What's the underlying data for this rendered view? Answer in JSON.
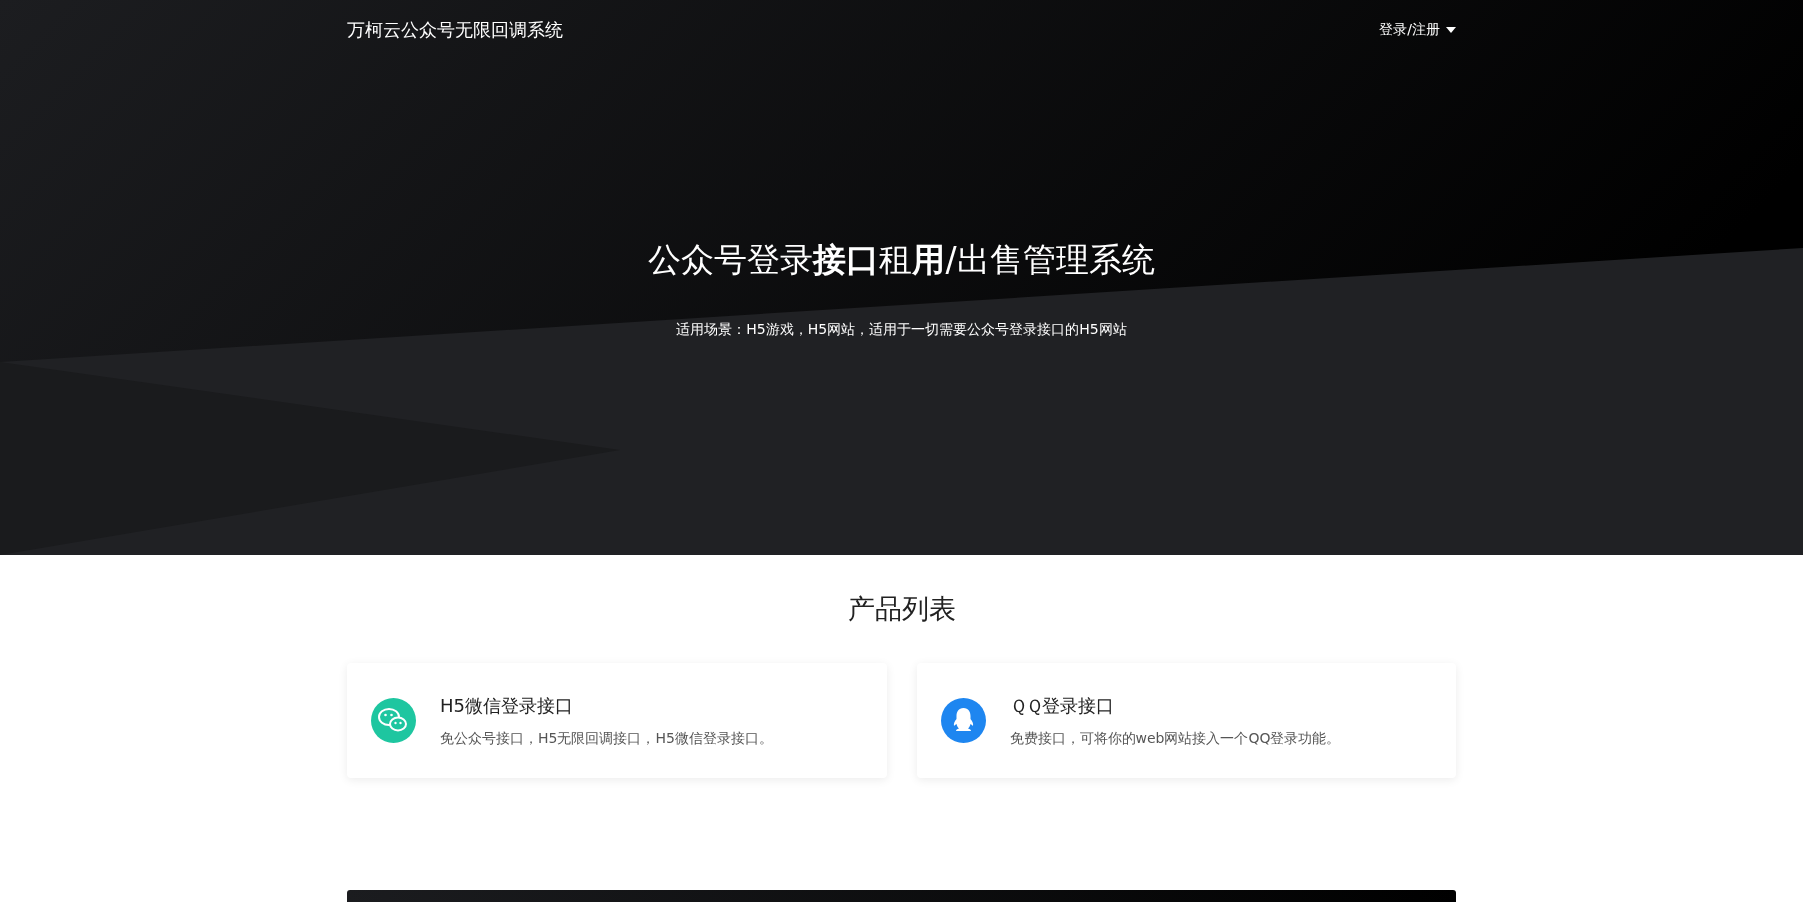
{
  "navbar": {
    "brand": "万柯云公众号无限回调系统",
    "login_menu": "登录/注册"
  },
  "hero": {
    "title": "公众号登录**接口**租**用**/出售管理系统",
    "subtitle": "适用场景：H5游戏，H5网站，适用于一切需要公众号登录接口的H5网站"
  },
  "products": {
    "heading": "产品列表",
    "items": [
      {
        "kind": "wechat",
        "color": "#1ec6a0",
        "title": "H5微信登录接口",
        "description": "免公众号接口，H5无限回调接口，H5微信登录接口。"
      },
      {
        "kind": "qq",
        "color": "#1e86f0",
        "title": "ＱＱ登录接口",
        "description": "免费接口，可将你的web网站接入一个QQ登录功能。"
      }
    ]
  }
}
